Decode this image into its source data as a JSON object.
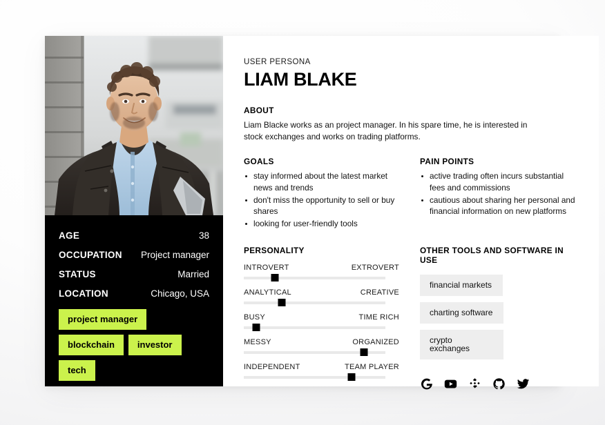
{
  "card": {
    "eyebrow": "USER PERSONA",
    "name": "LIAM BLAKE"
  },
  "about": {
    "title": "ABOUT",
    "text": "Liam Blacke works as an project manager. In his spare time, he is interested in stock exchanges and works on trading platforms."
  },
  "goals": {
    "title": "GOALS",
    "items": [
      "stay informed about the latest market news and trends",
      "don't miss the opportunity to sell or buy shares",
      "looking for user-friendly tools"
    ]
  },
  "pain_points": {
    "title": "PAIN POINTS",
    "items": [
      "active trading often incurs substantial fees and commissions",
      "cautious about sharing her personal and financial information on new platforms"
    ]
  },
  "personality": {
    "title": "PERSONALITY",
    "sliders": [
      {
        "left": "INTROVERT",
        "right": "EXTROVERT",
        "value": 22
      },
      {
        "left": "ANALYTICAL",
        "right": "CREATIVE",
        "value": 27
      },
      {
        "left": "BUSY",
        "right": "TIME RICH",
        "value": 9
      },
      {
        "left": "MESSY",
        "right": "ORGANIZED",
        "value": 85
      },
      {
        "left": "INDEPENDENT",
        "right": "TEAM PLAYER",
        "value": 76
      }
    ]
  },
  "tools": {
    "title": "OTHER TOOLS AND SOFTWARE IN USE",
    "items": [
      "financial markets",
      "charting software",
      "crypto exchanges"
    ]
  },
  "socials": [
    {
      "name": "google-icon",
      "label": "Google"
    },
    {
      "name": "youtube-icon",
      "label": "YouTube"
    },
    {
      "name": "binance-icon",
      "label": "Binance"
    },
    {
      "name": "github-icon",
      "label": "GitHub"
    },
    {
      "name": "twitter-icon",
      "label": "Twitter"
    }
  ],
  "facts": {
    "rows": [
      {
        "label": "AGE",
        "value": "38"
      },
      {
        "label": "OCCUPATION",
        "value": "Project manager"
      },
      {
        "label": "STATUS",
        "value": "Married"
      },
      {
        "label": "LOCATION",
        "value": "Chicago, USA"
      }
    ]
  },
  "tags": [
    "project manager",
    "blockchain",
    "investor",
    "tech"
  ],
  "colors": {
    "accent_green": "#CBF24C",
    "panel_black": "#000000",
    "chip_gray": "#eeeeee"
  }
}
